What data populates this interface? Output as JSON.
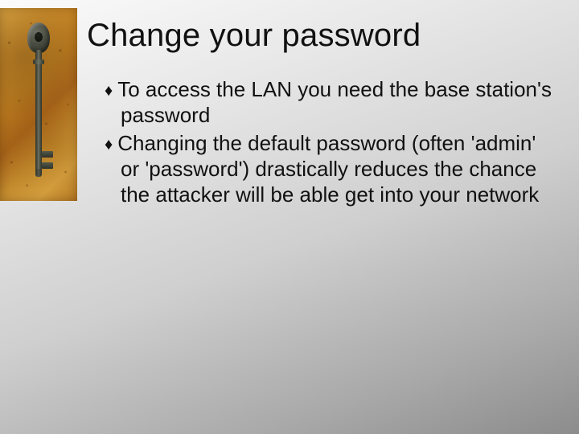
{
  "title": "Change your password",
  "bullet_glyph": "♦",
  "bullets": [
    "To access the LAN you need the base station's password",
    "Changing the default password (often 'admin' or 'password') drastically reduces the chance the attacker will be able get into your network"
  ]
}
